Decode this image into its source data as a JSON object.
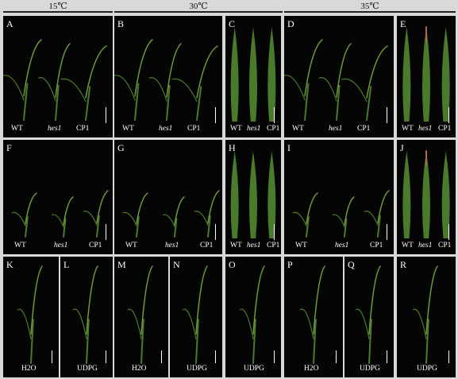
{
  "headers": [
    "15℃",
    "30℃",
    "35℃"
  ],
  "panels": [
    {
      "id": "A",
      "labels": [
        "WT",
        "hes1",
        "CP1"
      ]
    },
    {
      "id": "B",
      "labels": [
        "WT",
        "hes1",
        "CP1"
      ]
    },
    {
      "id": "C",
      "labels": [
        "WT",
        "hes1",
        "CP1"
      ]
    },
    {
      "id": "D",
      "labels": [
        "WT",
        "hes1",
        "CP1"
      ]
    },
    {
      "id": "E",
      "labels": [
        "WT",
        "hes1",
        "CP1"
      ]
    },
    {
      "id": "F",
      "labels": [
        "WT",
        "hes1",
        "CP1"
      ]
    },
    {
      "id": "G",
      "labels": [
        "WT",
        "hes1",
        "CP1"
      ]
    },
    {
      "id": "H",
      "labels": [
        "WT",
        "hes1",
        "CP1"
      ]
    },
    {
      "id": "I",
      "labels": [
        "WT",
        "hes1",
        "CP1"
      ]
    },
    {
      "id": "J",
      "labels": [
        "WT",
        "hes1",
        "CP1"
      ]
    },
    {
      "id": "K",
      "labels": [
        "H2O"
      ]
    },
    {
      "id": "L",
      "labels": [
        "UDPG"
      ]
    },
    {
      "id": "M",
      "labels": [
        "H2O"
      ]
    },
    {
      "id": "N",
      "labels": [
        "UDPG"
      ]
    },
    {
      "id": "O",
      "labels": [
        "UDPG"
      ]
    },
    {
      "id": "P",
      "labels": [
        "H2O"
      ]
    },
    {
      "id": "Q",
      "labels": [
        "UDPG"
      ]
    },
    {
      "id": "R",
      "labels": [
        "UDPG"
      ]
    }
  ],
  "colors": {
    "background": "#d9d9d9",
    "panel": "#050505",
    "leaf": "#4a7a2c",
    "leaf_light": "#6f9a3a",
    "leaf_tip": "#b06a4a"
  }
}
